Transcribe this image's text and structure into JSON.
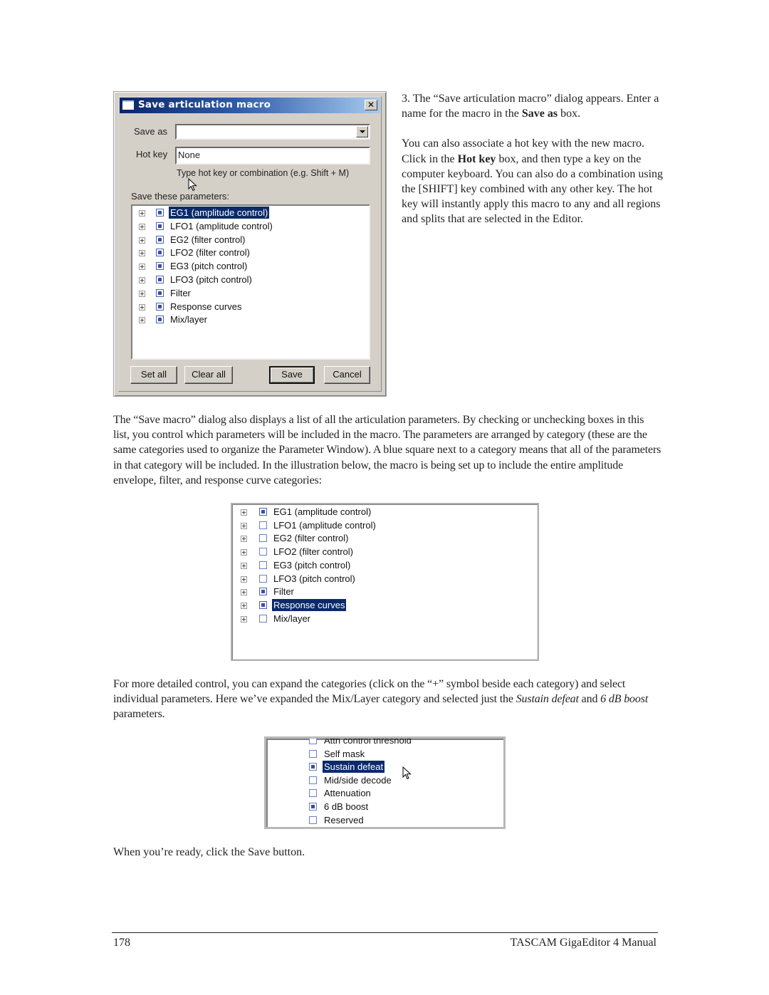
{
  "dialog": {
    "title": "Save articulation macro",
    "close_glyph": "✕",
    "save_as_label": "Save as",
    "save_as_value": "",
    "hot_key_label": "Hot key",
    "hot_key_value": "None",
    "hot_key_hint": "Type hot key or combination (e.g. Shift + M)",
    "parameters_label": "Save these parameters:",
    "parameters": [
      {
        "label": "EG1 (amplitude control)",
        "checked": true,
        "selected": true
      },
      {
        "label": "LFO1 (amplitude control)",
        "checked": true,
        "selected": false
      },
      {
        "label": "EG2 (filter control)",
        "checked": true,
        "selected": false
      },
      {
        "label": "LFO2 (filter control)",
        "checked": true,
        "selected": false
      },
      {
        "label": "EG3 (pitch control)",
        "checked": true,
        "selected": false
      },
      {
        "label": "LFO3 (pitch control)",
        "checked": true,
        "selected": false
      },
      {
        "label": "Filter",
        "checked": true,
        "selected": false
      },
      {
        "label": "Response curves",
        "checked": true,
        "selected": false
      },
      {
        "label": "Mix/layer",
        "checked": true,
        "selected": false
      }
    ],
    "buttons": {
      "set_all": "Set all",
      "clear_all": "Clear all",
      "save": "Save",
      "cancel": "Cancel"
    }
  },
  "right_column": {
    "p1_prefix": "3. The “Save articulation macro” dialog appears. Enter a name for the macro in the ",
    "p1_bold": "Save as",
    "p1_suffix": " box.",
    "p2_prefix": " You can also associate a hot key with the new macro.  Click in the ",
    "p2_bold": "Hot key",
    "p2_suffix": " box, and then type a key on the computer keyboard.  You can also do a combination using the [SHIFT] key combined with any other key.  The hot key will instantly apply this macro to any and all regions and splits that are selected in the Editor."
  },
  "body": {
    "para1": "The “Save macro” dialog also displays a list of all the articulation parameters.  By checking or unchecking boxes in this list, you control which parameters will be included in the macro.  The parameters are arranged by category (these are the same categories used to organize the Parameter Window).  A blue square next to a category means that all of the parameters in that category will be included.  In the illustration below, the macro is being set up to include the entire amplitude envelope, filter, and response curve categories:",
    "para2_prefix": "For more detailed control, you can expand the categories (click on the “+” symbol beside each category) and select individual parameters.  Here we’ve expanded the Mix/Layer category and selected just the ",
    "para2_italic1": "Sustain defeat",
    "para2_mid": " and ",
    "para2_italic2": "6 dB boost",
    "para2_suffix": " parameters.",
    "para3": "When you’re ready, click the Save button."
  },
  "category_list": [
    {
      "label": "EG1 (amplitude control)",
      "checked": true,
      "selected": false
    },
    {
      "label": "LFO1 (amplitude control)",
      "checked": false,
      "selected": false
    },
    {
      "label": "EG2 (filter control)",
      "checked": false,
      "selected": false
    },
    {
      "label": "LFO2 (filter control)",
      "checked": false,
      "selected": false
    },
    {
      "label": "EG3 (pitch control)",
      "checked": false,
      "selected": false
    },
    {
      "label": "LFO3 (pitch control)",
      "checked": false,
      "selected": false
    },
    {
      "label": "Filter",
      "checked": true,
      "selected": false
    },
    {
      "label": "Response curves",
      "checked": true,
      "selected": true
    },
    {
      "label": "Mix/layer",
      "checked": false,
      "selected": false
    }
  ],
  "mix_layer_list": [
    {
      "label": "Attn control threshold",
      "checked": false,
      "selected": false
    },
    {
      "label": "Self mask",
      "checked": false,
      "selected": false
    },
    {
      "label": "Sustain defeat",
      "checked": true,
      "selected": true
    },
    {
      "label": "Mid/side decode",
      "checked": false,
      "selected": false
    },
    {
      "label": "Attenuation",
      "checked": false,
      "selected": false
    },
    {
      "label": "6 dB boost",
      "checked": true,
      "selected": false
    },
    {
      "label": "Reserved",
      "checked": false,
      "selected": false
    }
  ],
  "footer": {
    "page_number": "178",
    "manual_title": "TASCAM GigaEditor 4 Manual"
  }
}
